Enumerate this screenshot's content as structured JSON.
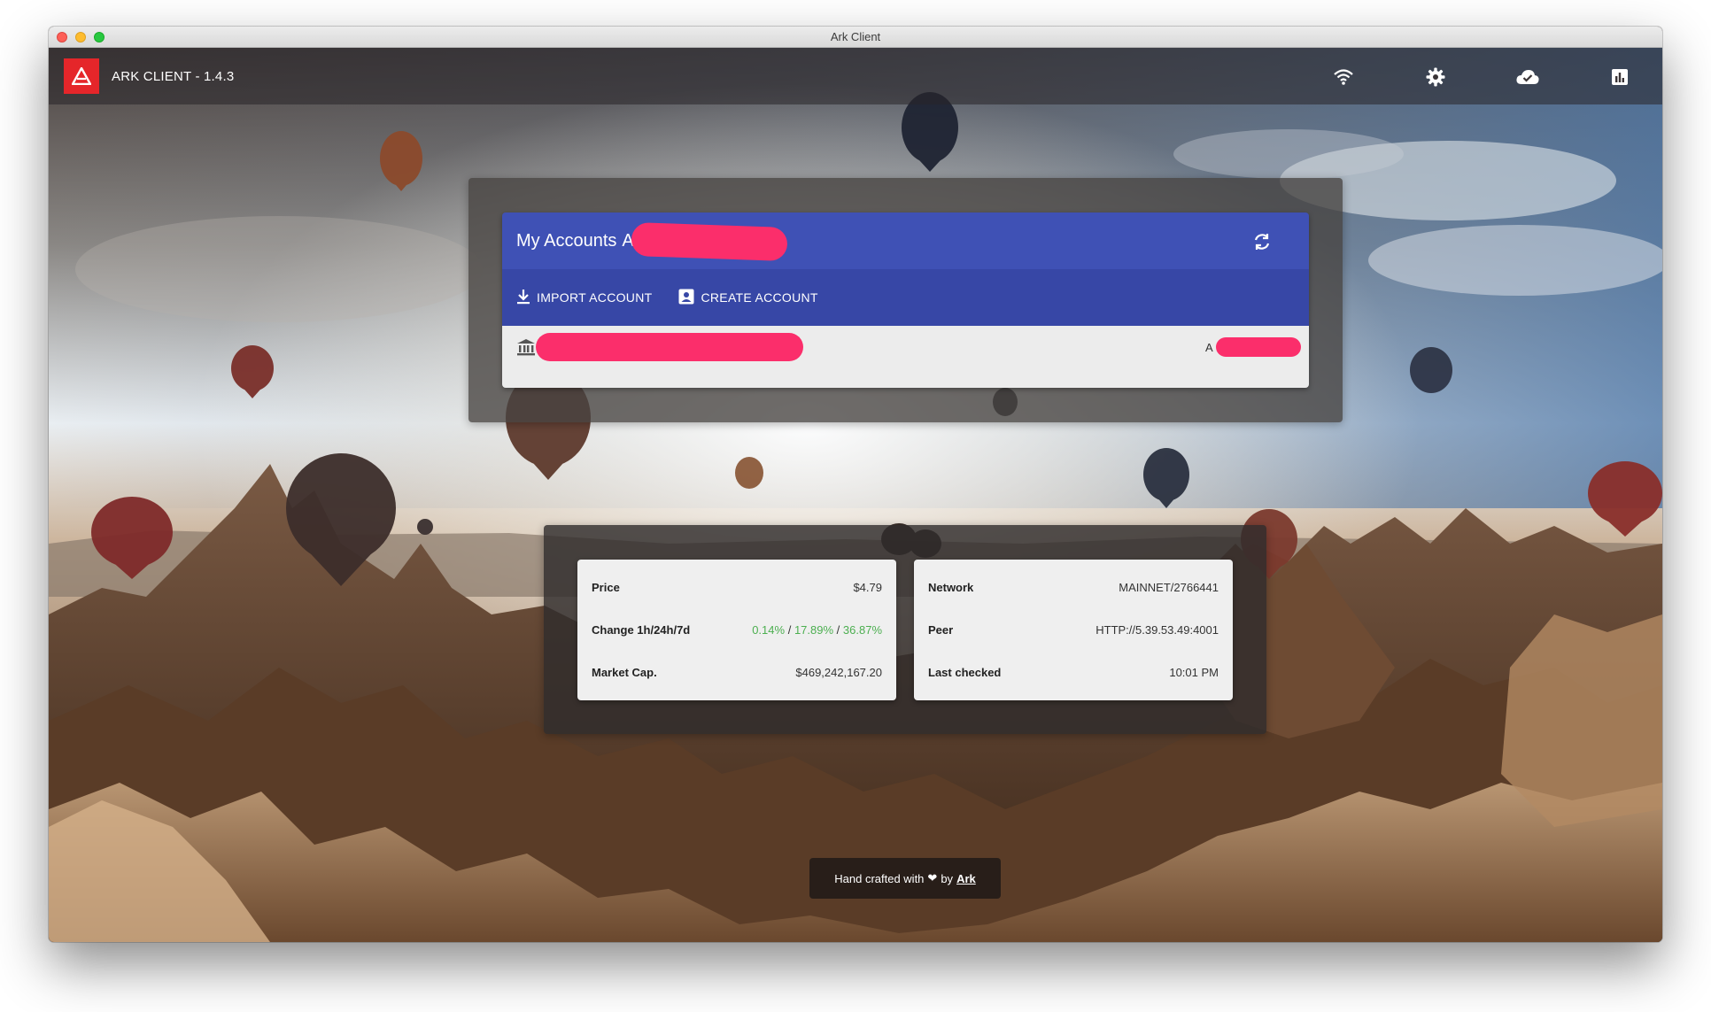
{
  "window": {
    "title": "Ark Client"
  },
  "app": {
    "title": "ARK CLIENT - 1.4.3"
  },
  "header_icons": [
    "wifi-icon",
    "gear-icon",
    "cloud-check-icon",
    "chart-icon",
    "power-icon"
  ],
  "accounts": {
    "title": "My Accounts",
    "title_fragment": "A",
    "import_label": "IMPORT ACCOUNT",
    "create_label": "CREATE ACCOUNT",
    "row_address_prefix": "A"
  },
  "market": {
    "price_label": "Price",
    "price_value": "$4.79",
    "change_label": "Change 1h/24h/7d",
    "change_1h": "0.14%",
    "change_24h": "17.89%",
    "change_7d": "36.87%",
    "change_sep": "/",
    "marketcap_label": "Market Cap.",
    "marketcap_value": "$469,242,167.20"
  },
  "network": {
    "network_label": "Network",
    "network_value": "MAINNET/2766441",
    "peer_label": "Peer",
    "peer_value": "HTTP://5.39.53.49:4001",
    "checked_label": "Last checked",
    "checked_value": "10:01 PM"
  },
  "footer": {
    "text": "Hand crafted with",
    "heart": "❤",
    "by": "by",
    "link": "Ark"
  },
  "colors": {
    "accent": "#3f51b5",
    "accent_dark": "#3747a6",
    "logo_red": "#e5262a",
    "positive": "#4caf50",
    "redaction": "#fb2e6b"
  }
}
